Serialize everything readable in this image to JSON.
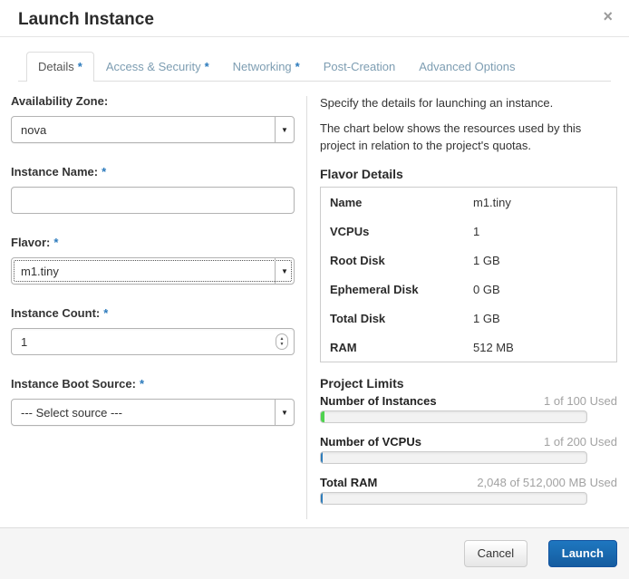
{
  "modal": {
    "title": "Launch Instance"
  },
  "icons": {
    "close": "×",
    "dropdown_arrow": "▼",
    "spinner_up": "▲",
    "spinner_down": "▼"
  },
  "required_marker": "*",
  "tabs": [
    {
      "label": "Details",
      "required": true,
      "active": true
    },
    {
      "label": "Access & Security",
      "required": true,
      "active": false
    },
    {
      "label": "Networking",
      "required": true,
      "active": false
    },
    {
      "label": "Post-Creation",
      "required": false,
      "active": false
    },
    {
      "label": "Advanced Options",
      "required": false,
      "active": false
    }
  ],
  "form": {
    "availability_zone": {
      "label": "Availability Zone:",
      "value": "nova",
      "required": false
    },
    "instance_name": {
      "label": "Instance Name:",
      "value": "",
      "required": true
    },
    "flavor": {
      "label": "Flavor:",
      "value": "m1.tiny",
      "required": true
    },
    "instance_count": {
      "label": "Instance Count:",
      "value": "1",
      "required": true
    },
    "boot_source": {
      "label": "Instance Boot Source:",
      "value": "--- Select source ---",
      "required": true
    }
  },
  "help": {
    "line1": "Specify the details for launching an instance.",
    "line2": "The chart below shows the resources used by this project in relation to the project's quotas."
  },
  "flavor_details": {
    "heading": "Flavor Details",
    "rows": [
      {
        "label": "Name",
        "value": "m1.tiny"
      },
      {
        "label": "VCPUs",
        "value": "1"
      },
      {
        "label": "Root Disk",
        "value": "1 GB"
      },
      {
        "label": "Ephemeral Disk",
        "value": "0 GB"
      },
      {
        "label": "Total Disk",
        "value": "1 GB"
      },
      {
        "label": "RAM",
        "value": "512 MB"
      }
    ]
  },
  "project_limits": {
    "heading": "Project Limits",
    "quotas": [
      {
        "label": "Number of Instances",
        "usage": "1 of 100 Used",
        "percent": 1.3,
        "color": "#4fd24f"
      },
      {
        "label": "Number of VCPUs",
        "usage": "1 of 200 Used",
        "percent": 0.7,
        "color": "#2e7cba"
      },
      {
        "label": "Total RAM",
        "usage": "2,048 of 512,000 MB Used",
        "percent": 0.6,
        "color": "#2e7cba"
      }
    ]
  },
  "footer": {
    "cancel_label": "Cancel",
    "launch_label": "Launch"
  },
  "colors": {
    "accent_blue": "#1e77c0",
    "required_blue": "#2b7abc",
    "quota_green": "#4fd24f",
    "quota_blue": "#2e7cba",
    "tab_inactive": "#7d9db2",
    "footer_bg": "#f5f5f5"
  }
}
